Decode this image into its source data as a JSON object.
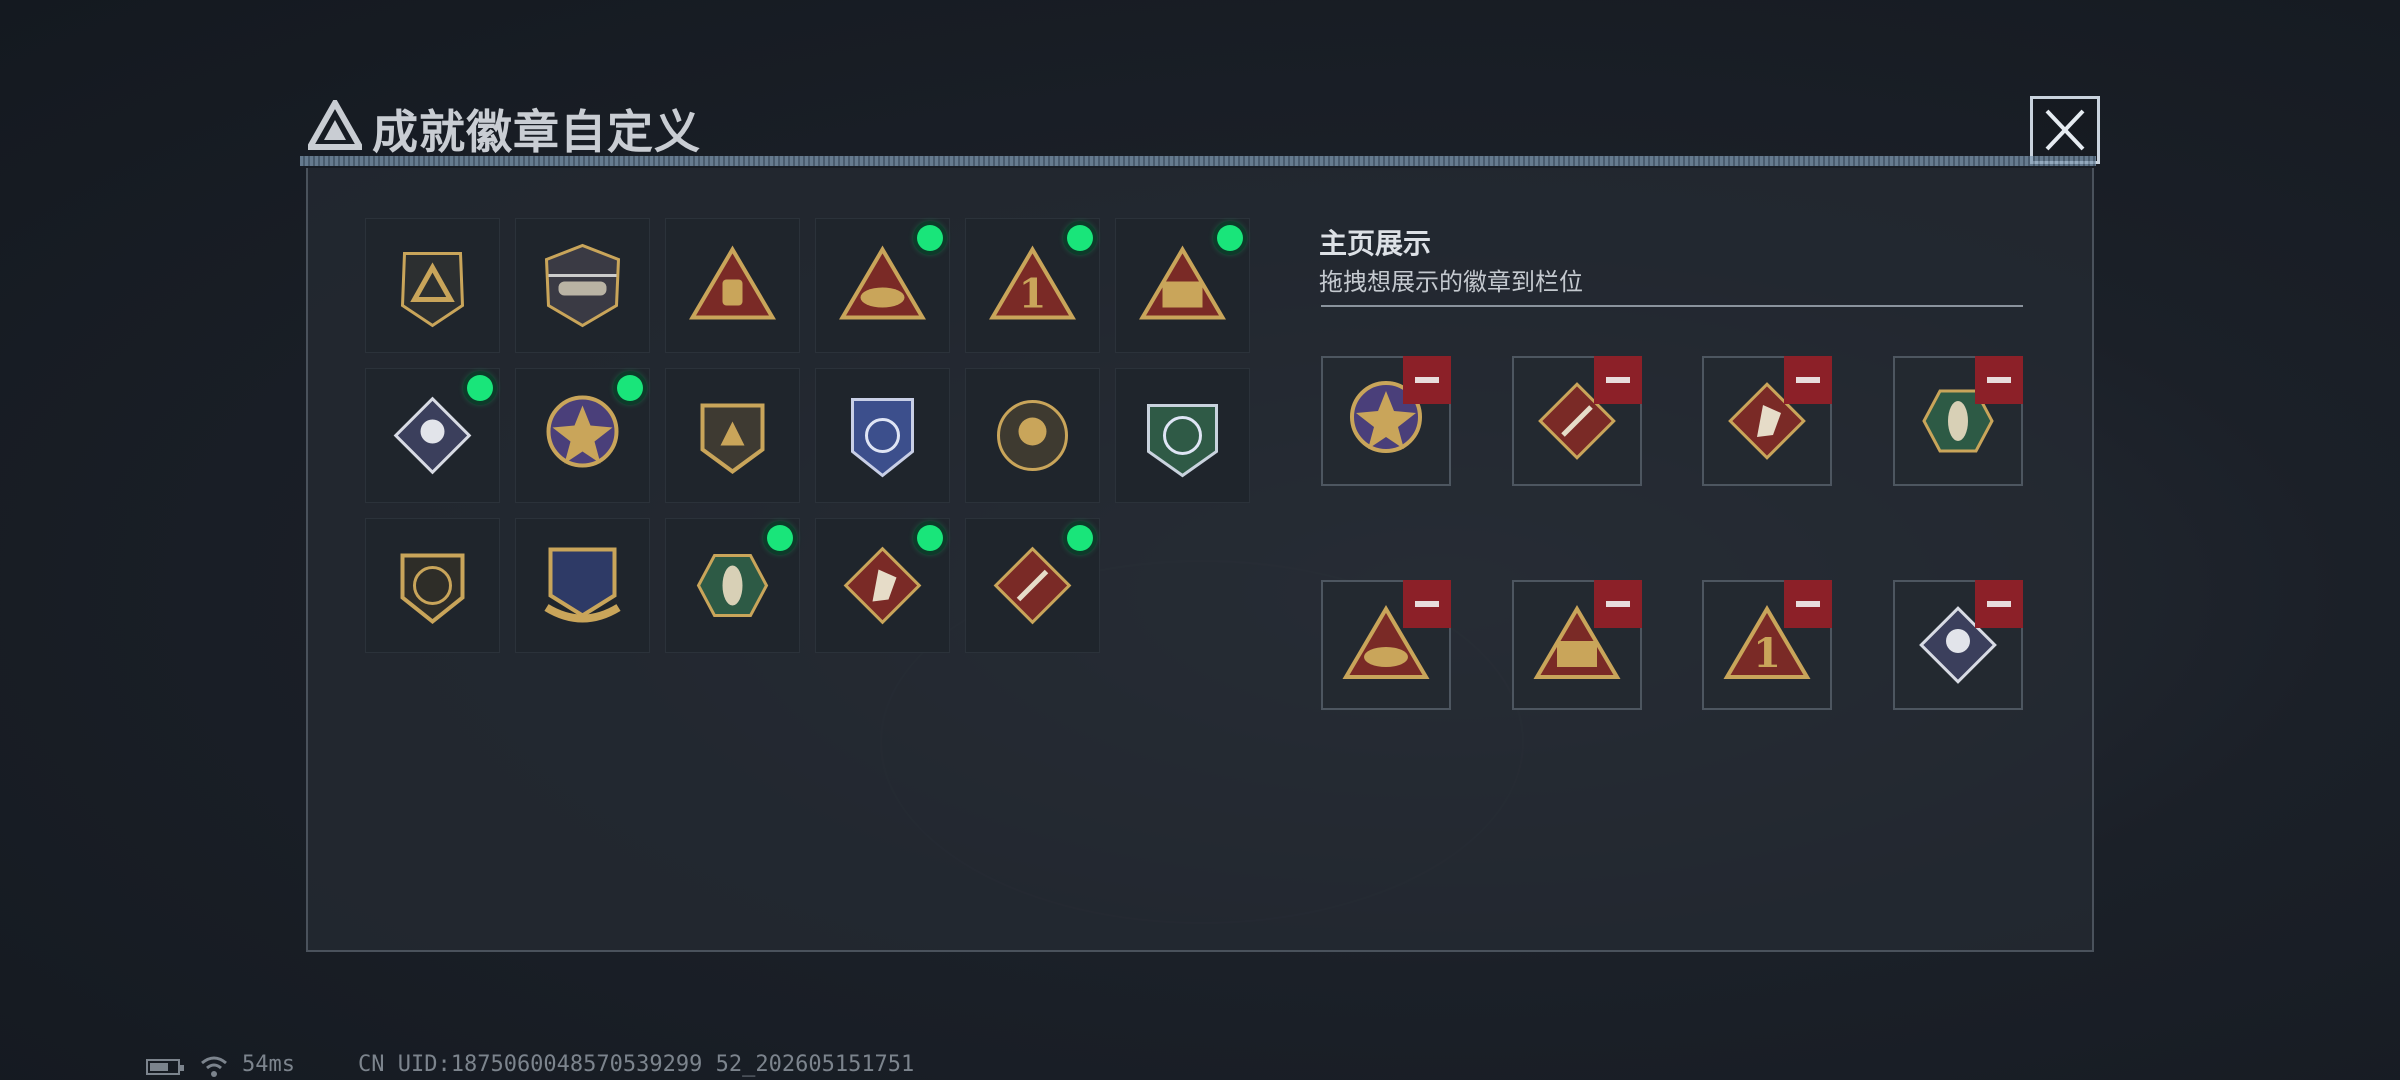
{
  "header": {
    "title": "成就徽章自定义",
    "tiny_text": ""
  },
  "display": {
    "title": "主页展示",
    "subtitle": "拖拽想展示的徽章到栏位"
  },
  "badges": [
    {
      "icon": "triangle-logo-badge-icon",
      "selected": false
    },
    {
      "icon": "helicopter-badge-icon",
      "selected": false
    },
    {
      "icon": "hand-sign-badge-icon",
      "selected": false
    },
    {
      "icon": "eagle-triangle-badge-icon",
      "selected": true
    },
    {
      "icon": "number-one-badge-icon",
      "selected": true
    },
    {
      "icon": "soldiers-badge-icon",
      "selected": true
    },
    {
      "icon": "rose-badge-icon",
      "selected": true
    },
    {
      "icon": "star-medal-badge-icon",
      "selected": true
    },
    {
      "icon": "shield-emblem-badge-icon",
      "selected": false
    },
    {
      "icon": "blue-shield-badge-icon",
      "selected": false
    },
    {
      "icon": "skull-badge-icon",
      "selected": false
    },
    {
      "icon": "rifle-crosshair-badge-icon",
      "selected": false
    },
    {
      "icon": "gun-shield-badge-icon",
      "selected": false
    },
    {
      "icon": "crossed-swords-badge-icon",
      "selected": false
    },
    {
      "icon": "hornet-badge-icon",
      "selected": true
    },
    {
      "icon": "horse-badge-icon",
      "selected": true
    },
    {
      "icon": "tools-badge-icon",
      "selected": true
    }
  ],
  "slots": [
    {
      "icon": "star-medal-badge-icon"
    },
    {
      "icon": "tools-badge-icon"
    },
    {
      "icon": "horse-badge-icon"
    },
    {
      "icon": "hornet-badge-icon"
    },
    {
      "icon": "eagle-triangle-badge-icon"
    },
    {
      "icon": "soldiers-badge-icon"
    },
    {
      "icon": "number-one-badge-icon"
    },
    {
      "icon": "rose-badge-icon"
    }
  ],
  "status": {
    "ping": "54ms",
    "uid": "CN UID:1875060048570539299 52_202605151751"
  },
  "colors": {
    "gold": "#c9a55a",
    "dark_red": "#7a2a26",
    "select_dot": "#19e57a",
    "remove_red": "#8c2028"
  }
}
